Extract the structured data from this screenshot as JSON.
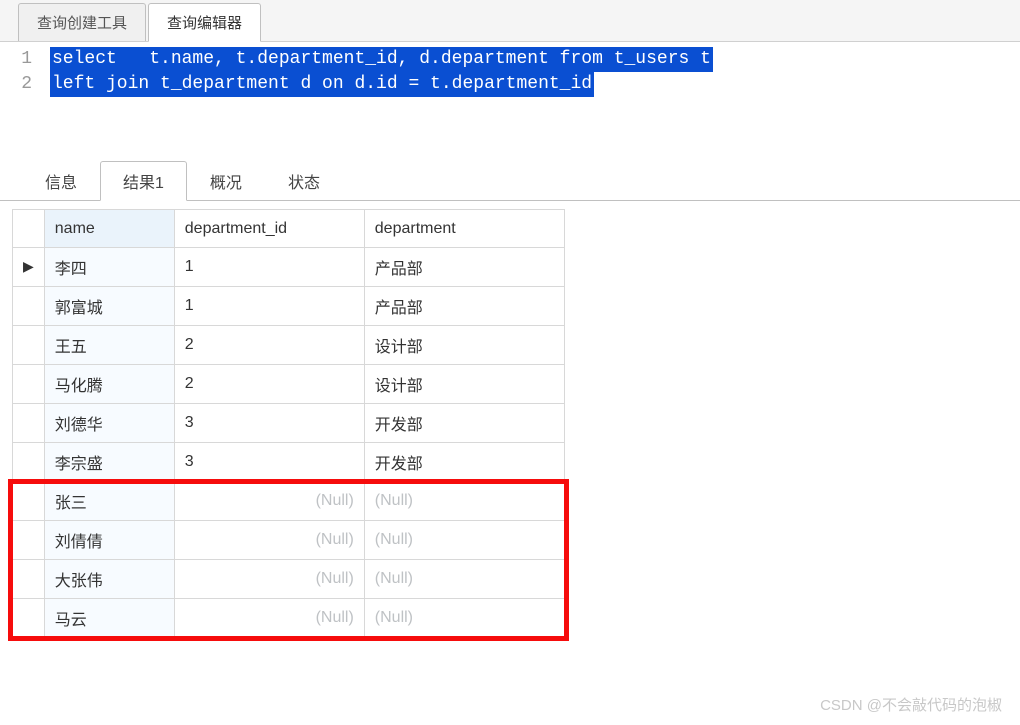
{
  "topTabs": [
    {
      "label": "查询创建工具",
      "active": false
    },
    {
      "label": "查询编辑器",
      "active": true
    }
  ],
  "sql": {
    "lines": [
      "select   t.name, t.department_id, d.department from t_users t",
      "left join t_department d on d.id = t.department_id"
    ]
  },
  "resultTabs": [
    {
      "label": "信息",
      "active": false
    },
    {
      "label": "结果1",
      "active": true
    },
    {
      "label": "概况",
      "active": false
    },
    {
      "label": "状态",
      "active": false
    }
  ],
  "columns": [
    "name",
    "department_id",
    "department"
  ],
  "rows": [
    {
      "name": "李四",
      "department_id": "1",
      "department": "产品部",
      "current": true
    },
    {
      "name": "郭富城",
      "department_id": "1",
      "department": "产品部",
      "current": false
    },
    {
      "name": "王五",
      "department_id": "2",
      "department": "设计部",
      "current": false
    },
    {
      "name": "马化腾",
      "department_id": "2",
      "department": "设计部",
      "current": false
    },
    {
      "name": "刘德华",
      "department_id": "3",
      "department": "开发部",
      "current": false
    },
    {
      "name": "李宗盛",
      "department_id": "3",
      "department": "开发部",
      "current": false
    },
    {
      "name": "张三",
      "department_id": null,
      "department": null,
      "current": false
    },
    {
      "name": "刘倩倩",
      "department_id": null,
      "department": null,
      "current": false
    },
    {
      "name": "大张伟",
      "department_id": null,
      "department": null,
      "current": false
    },
    {
      "name": "马云",
      "department_id": null,
      "department": null,
      "current": false
    }
  ],
  "nullText": "(Null)",
  "highlightRowsStart": 6,
  "watermark": "CSDN @不会敲代码的泡椒"
}
